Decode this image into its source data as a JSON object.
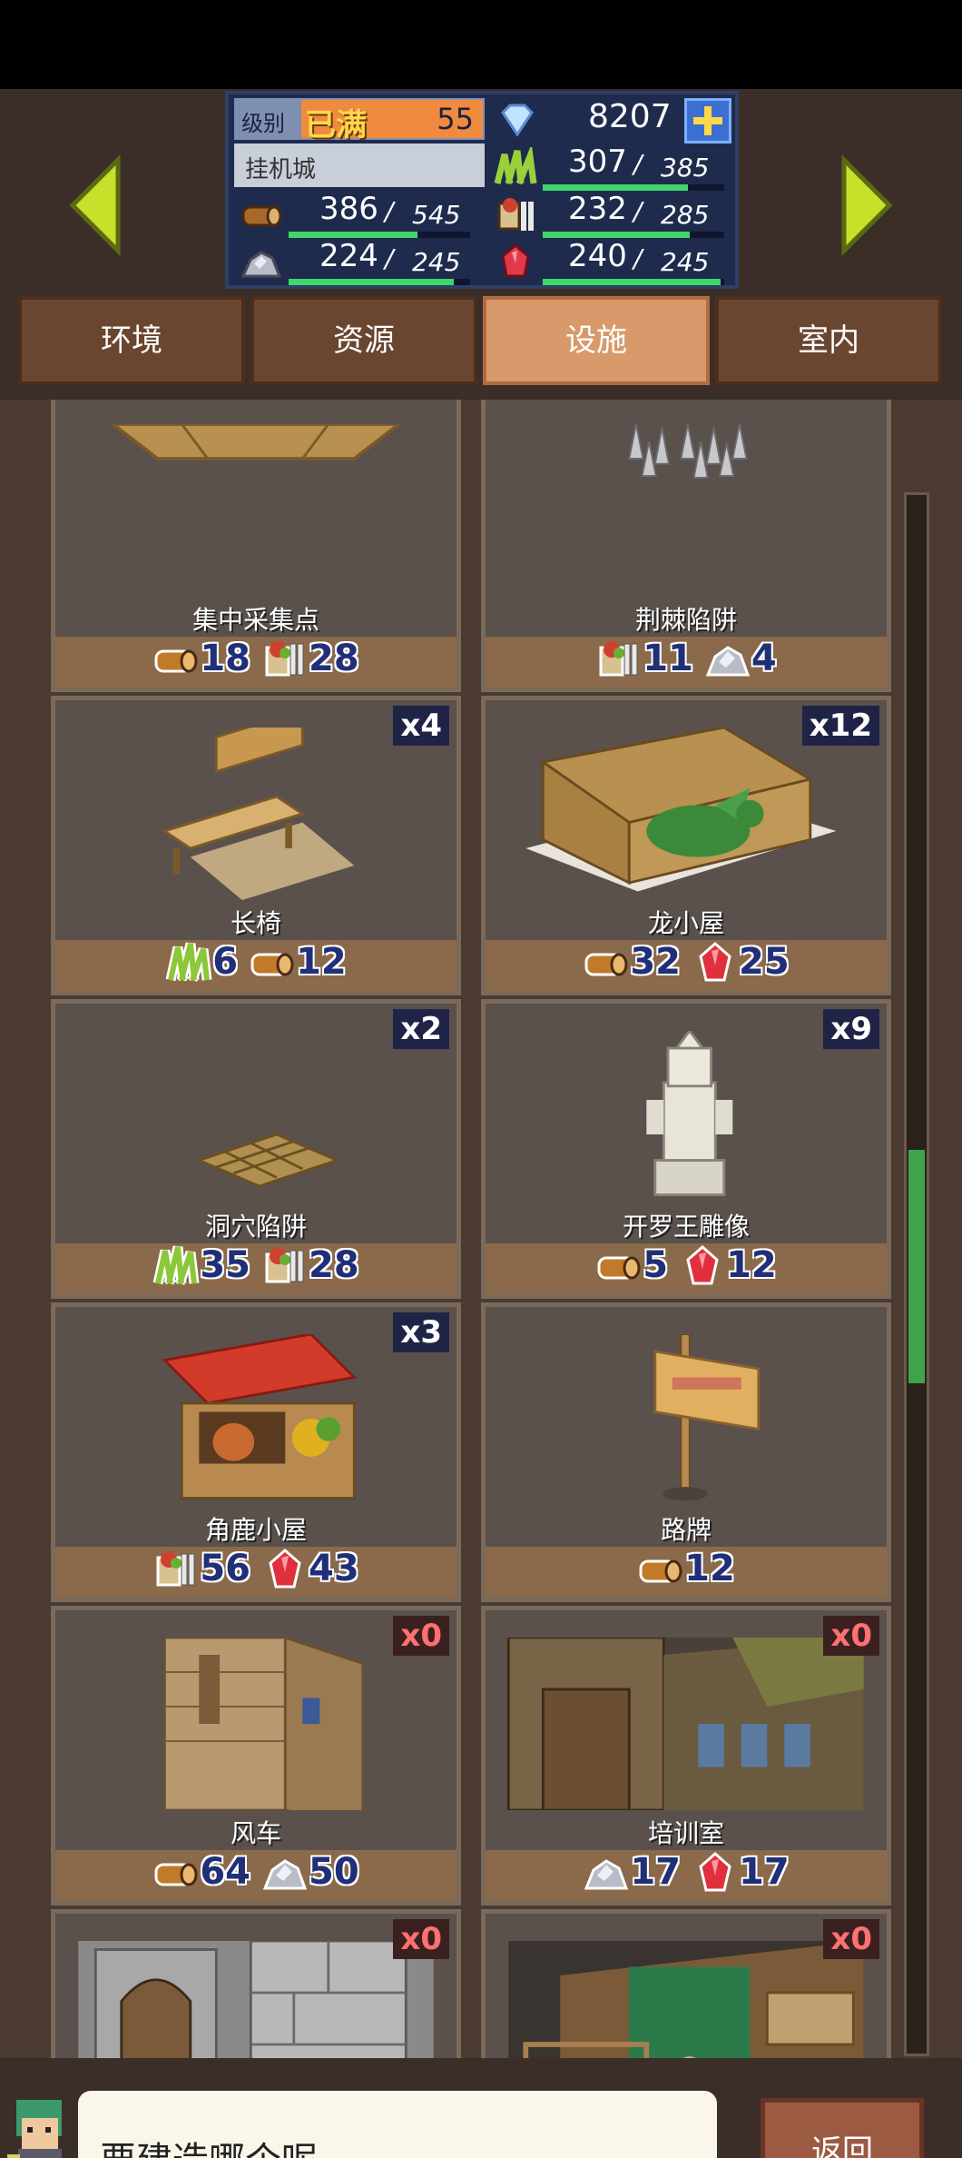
{
  "status": {
    "level_label": "级别",
    "max_label": "已满",
    "level_value": "55",
    "gems": "8207",
    "town_name": "挂机城",
    "resources": [
      {
        "icon": "grass-icon",
        "value": "307",
        "capacity": "385",
        "fill": 0.8
      },
      {
        "icon": "wood-icon",
        "value": "386",
        "capacity": "545",
        "fill": 0.71
      },
      {
        "icon": "food-icon",
        "value": "232",
        "capacity": "285",
        "fill": 0.81
      },
      {
        "icon": "ore-icon",
        "value": "224",
        "capacity": "245",
        "fill": 0.91
      },
      {
        "icon": "red-gem-icon",
        "value": "240",
        "capacity": "245",
        "fill": 0.98
      }
    ]
  },
  "tabs": [
    {
      "label": "环境",
      "active": false
    },
    {
      "label": "资源",
      "active": false
    },
    {
      "label": "设施",
      "active": true
    },
    {
      "label": "室内",
      "active": false
    }
  ],
  "items": [
    {
      "name": "集中采集点",
      "count": "",
      "costs": [
        {
          "icon": "wood-icon",
          "value": "18"
        },
        {
          "icon": "food-icon",
          "value": "28"
        }
      ]
    },
    {
      "name": "荆棘陷阱",
      "count": "",
      "costs": [
        {
          "icon": "food-icon",
          "value": "11"
        },
        {
          "icon": "ore-icon",
          "value": "4"
        }
      ]
    },
    {
      "name": "长椅",
      "count": "x4",
      "costs": [
        {
          "icon": "grass-icon",
          "value": "6"
        },
        {
          "icon": "wood-icon",
          "value": "12"
        }
      ]
    },
    {
      "name": "龙小屋",
      "count": "x12",
      "costs": [
        {
          "icon": "wood-icon",
          "value": "32"
        },
        {
          "icon": "red-gem-icon",
          "value": "25"
        }
      ]
    },
    {
      "name": "洞穴陷阱",
      "count": "x2",
      "costs": [
        {
          "icon": "grass-icon",
          "value": "35"
        },
        {
          "icon": "food-icon",
          "value": "28"
        }
      ]
    },
    {
      "name": "开罗王雕像",
      "count": "x9",
      "costs": [
        {
          "icon": "wood-icon",
          "value": "5"
        },
        {
          "icon": "red-gem-icon",
          "value": "12"
        }
      ]
    },
    {
      "name": "角鹿小屋",
      "count": "x3",
      "costs": [
        {
          "icon": "food-icon",
          "value": "56"
        },
        {
          "icon": "red-gem-icon",
          "value": "43"
        }
      ]
    },
    {
      "name": "路牌",
      "count": "",
      "costs": [
        {
          "icon": "wood-icon",
          "value": "12"
        }
      ]
    },
    {
      "name": "风车",
      "count": "x0",
      "costs": [
        {
          "icon": "wood-icon",
          "value": "64"
        },
        {
          "icon": "ore-icon",
          "value": "50"
        }
      ]
    },
    {
      "name": "培训室",
      "count": "x0",
      "costs": [
        {
          "icon": "ore-icon",
          "value": "17"
        },
        {
          "icon": "red-gem-icon",
          "value": "17"
        }
      ]
    },
    {
      "name": "",
      "count": "x0",
      "costs": []
    },
    {
      "name": "",
      "count": "x0",
      "costs": []
    }
  ],
  "scroll": {
    "position": 0.42,
    "visible": 0.15
  },
  "bottom": {
    "prompt": "要建造哪个呢",
    "back_label": "返回"
  }
}
